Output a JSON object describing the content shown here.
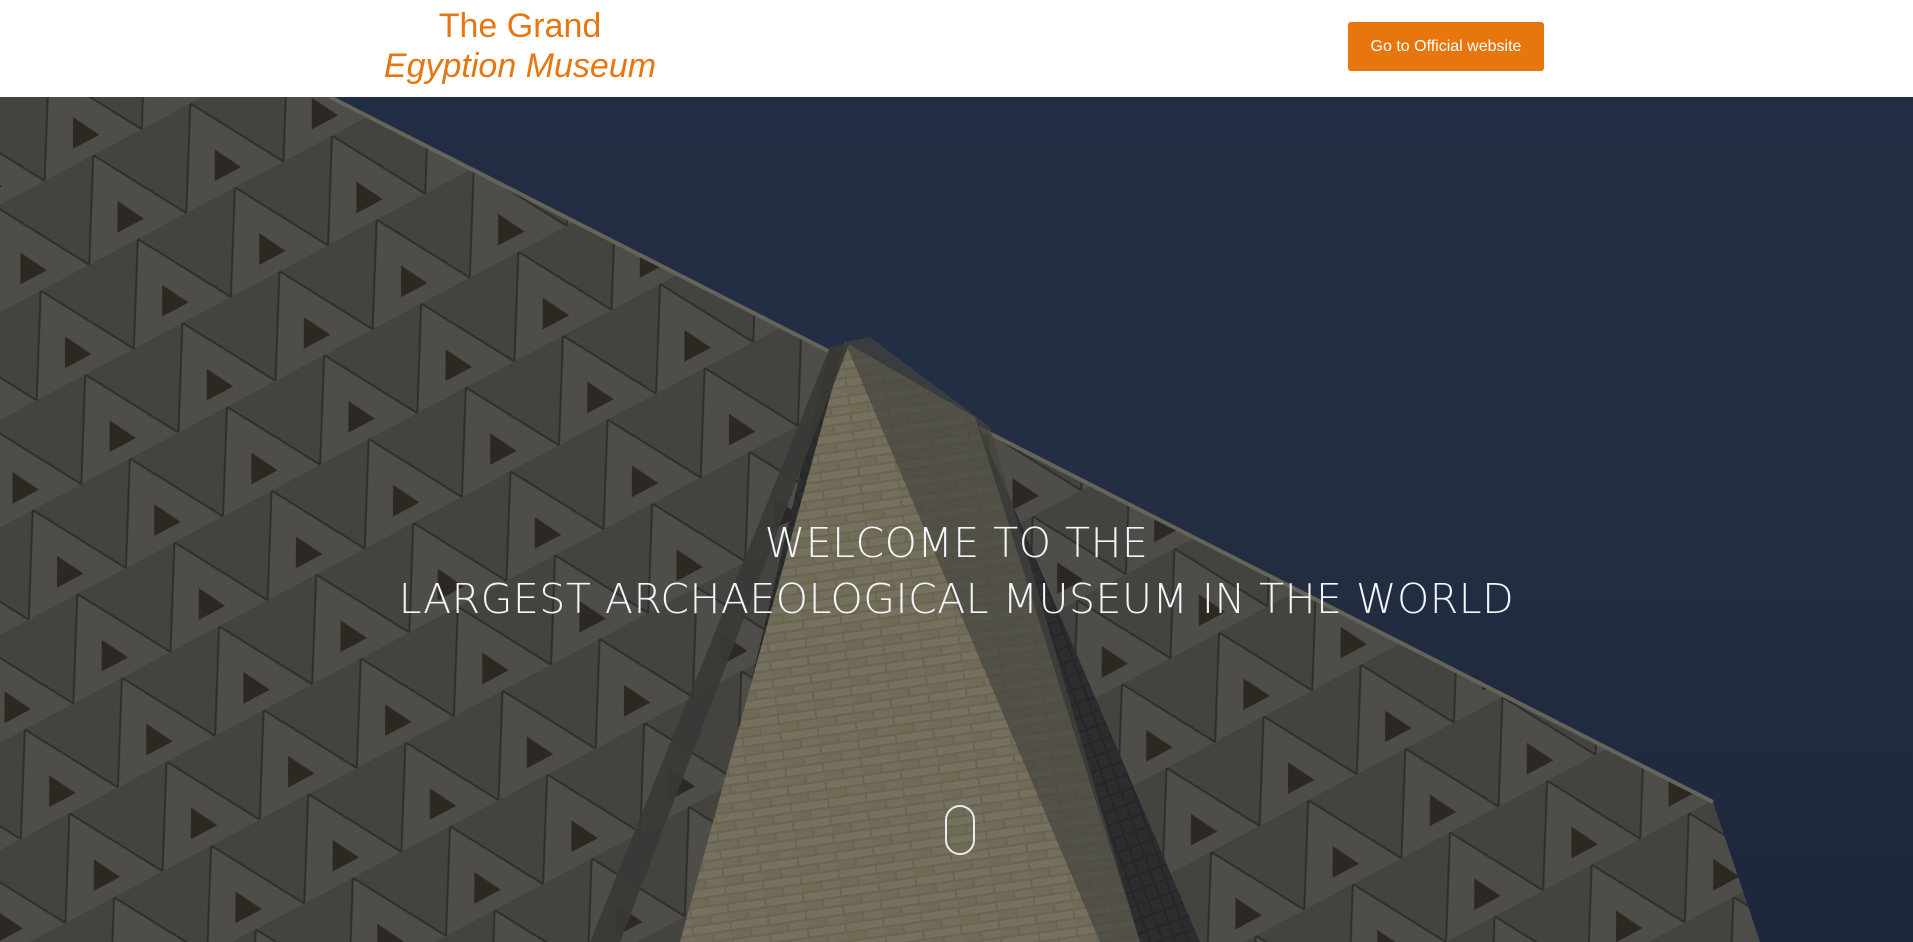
{
  "header": {
    "logo_line1": "The Grand",
    "logo_line2": "Egyption Museum",
    "cta_label": "Go to Official website"
  },
  "hero": {
    "headline_line1": "WELCOME TO THE",
    "headline_line2": "LARGEST ARCHAEOLOGICAL MUSEUM IN THE WORLD",
    "background_image": "museum-facade-photo"
  },
  "colors": {
    "accent": "#e8760f",
    "sky": "#2a3a57",
    "headline_text": "#f3f5f8"
  },
  "icons": [
    "scroll-down-mouse-icon"
  ]
}
